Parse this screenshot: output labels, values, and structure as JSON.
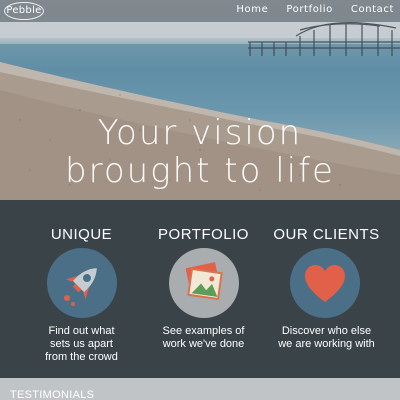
{
  "brand": {
    "logo_text": "Pebble"
  },
  "nav": {
    "items": [
      "Home",
      "Portfolio",
      "Contact"
    ]
  },
  "hero": {
    "line1": "Your vision",
    "line2": "brought to life"
  },
  "features": [
    {
      "title": "UNIQUE",
      "icon": "rocket-icon",
      "text": [
        "Find out what",
        "sets us apart",
        "from the crowd"
      ]
    },
    {
      "title": "PORTFOLIO",
      "icon": "photos-icon",
      "text": [
        "See examples of",
        "work we've done"
      ]
    },
    {
      "title": "OUR CLIENTS",
      "icon": "heart-icon",
      "text": [
        "Discover who else",
        "we are working with"
      ]
    }
  ],
  "testimonials": {
    "label": "TESTIMONIALS"
  },
  "colors": {
    "dark_bg": "#3a4348",
    "circle_blue": "#4a6f87",
    "circle_grey": "#a9adb0",
    "heart": "#e0604a"
  }
}
